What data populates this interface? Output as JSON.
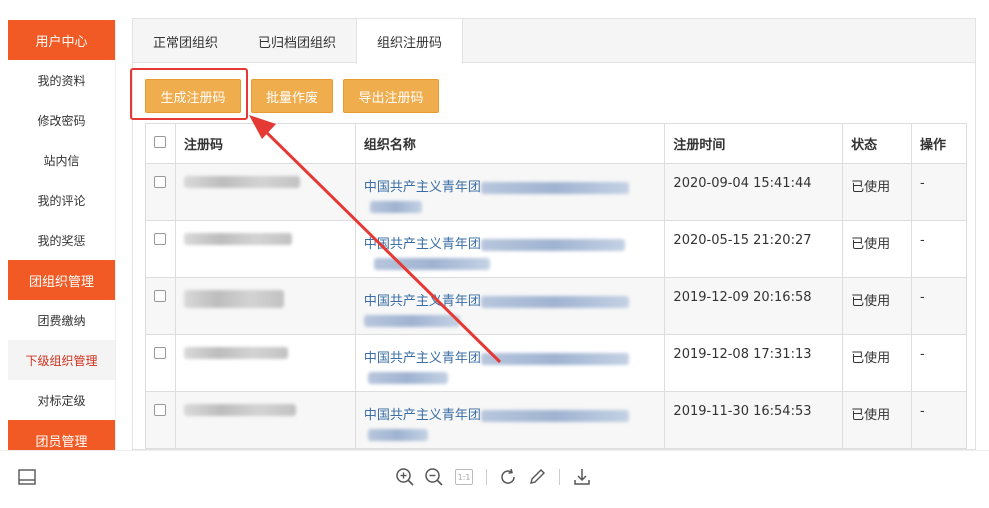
{
  "sidebar": {
    "sections": [
      {
        "title": "用户中心",
        "items": [
          "我的资料",
          "修改密码",
          "站内信",
          "我的评论",
          "我的奖惩"
        ]
      },
      {
        "title": "团组织管理",
        "items": [
          "团费缴纳",
          "下级组织管理",
          "对标定级"
        ]
      },
      {
        "title": "团员管理",
        "items": []
      }
    ],
    "active_item": "下级组织管理"
  },
  "tabs": [
    {
      "label": "正常团组织",
      "active": false
    },
    {
      "label": "已归档团组织",
      "active": false
    },
    {
      "label": "组织注册码",
      "active": true
    }
  ],
  "buttons": {
    "generate": "生成注册码",
    "batch_void": "批量作废",
    "export": "导出注册码"
  },
  "table": {
    "headers": {
      "code": "注册码",
      "name": "组织名称",
      "time": "注册时间",
      "status": "状态",
      "op": "操作"
    },
    "rows": [
      {
        "name_prefix": "中国共产主义青年团",
        "time": "2020-09-04 15:41:44",
        "status": "已使用",
        "op": "-"
      },
      {
        "name_prefix": "中国共产主义青年团",
        "time": "2020-05-15 21:20:27",
        "status": "已使用",
        "op": "-"
      },
      {
        "name_prefix": "中国共产主义青年团",
        "time": "2019-12-09 20:16:58",
        "status": "已使用",
        "op": "-"
      },
      {
        "name_prefix": "中国共产主义青年团",
        "time": "2019-12-08 17:31:13",
        "status": "已使用",
        "op": "-"
      },
      {
        "name_prefix": "中国共产主义青年团",
        "time": "2019-11-30 16:54:53",
        "status": "已使用",
        "op": "-"
      }
    ]
  },
  "toolbar": {
    "icons": [
      "layout-icon",
      "zoom-in-icon",
      "zoom-out-icon",
      "actual-size-icon",
      "rotate-icon",
      "edit-icon",
      "download-icon"
    ],
    "actual_size_label": "1:1"
  },
  "colors": {
    "accent": "#f15a24",
    "button": "#f0ad4e",
    "highlight": "#e53935",
    "link": "#3a6ea5"
  }
}
